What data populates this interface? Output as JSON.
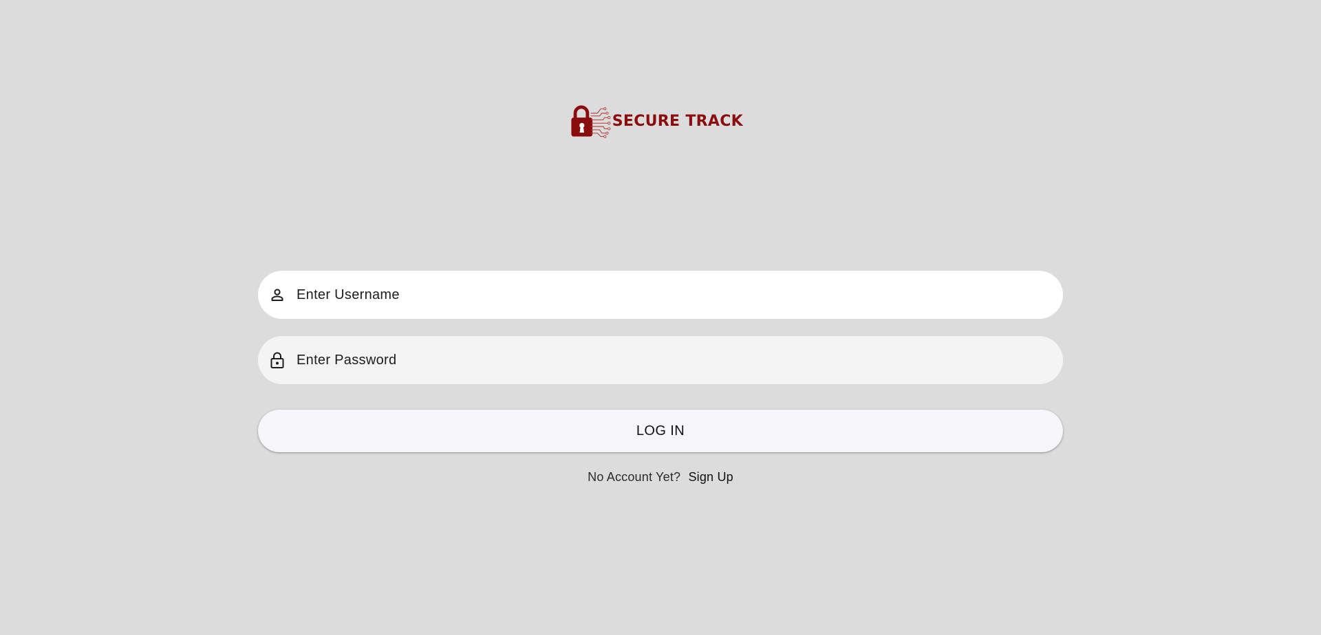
{
  "brand": {
    "name": "SECURE TRACK",
    "color": "#8b0c0c",
    "icon": "padlock-circuit-icon"
  },
  "form": {
    "username": {
      "placeholder": "Enter Username",
      "value": "",
      "icon": "person-icon"
    },
    "password": {
      "placeholder": "Enter Password",
      "value": "",
      "icon": "lock-icon"
    },
    "login_label": "LOG IN"
  },
  "signup": {
    "prompt": "No Account Yet?",
    "link_label": "Sign Up"
  },
  "colors": {
    "background": "#dcdcdc",
    "field_active": "#ffffff",
    "field_inactive": "#f4f4f4",
    "button": "#f6f5fa"
  }
}
